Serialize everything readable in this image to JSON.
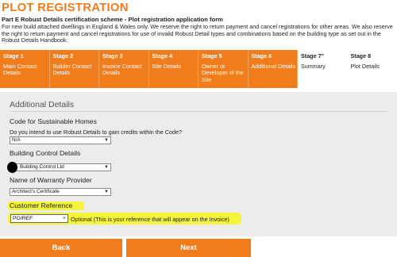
{
  "header": {
    "title": "PLOT REGISTRATION",
    "subtitle": "Part E Robust Details certification scheme - Plot registration application form",
    "intro": "For new build attached dwellings in England & Wales only. We reserve the right to return payment and cancel registrations for other areas. We also reserve the right to return payment and cancel registrations for use of invalid Robust Detail types and combinations based on the building type as set out in the Robust Details Handbook."
  },
  "steps": [
    {
      "label": "Stage 1",
      "desc": "Main Contact Details",
      "state": "completed"
    },
    {
      "label": "Stage 2",
      "desc": "Builder Contact Details",
      "state": "completed"
    },
    {
      "label": "Stage 3",
      "desc": "Invoice Contact Details",
      "state": "completed"
    },
    {
      "label": "Stage 4",
      "desc": "Site Details",
      "state": "completed"
    },
    {
      "label": "Stage 5",
      "desc": "Owner or Developer of the Site",
      "state": "completed"
    },
    {
      "label": "Stage 6",
      "desc": "Additional Details",
      "state": "current"
    },
    {
      "label": "Stage 7\"",
      "desc": "Summary",
      "state": "pending"
    },
    {
      "label": "Stage 8",
      "desc": "Plot Details",
      "state": "pending"
    }
  ],
  "form": {
    "title": "Additional Details",
    "code_section": "Code for Sustainable Homes",
    "code_question": "Do you intend to use Robust Details to gain credits within the Code?",
    "code_value": "N/A",
    "building_control_label": "Building Control Details",
    "building_control_value": "Building Control Ltd",
    "warranty_label": "Name of Warranty Provider",
    "warranty_value": "Architect's Certificate",
    "customer_ref_label": "Customer Reference",
    "customer_ref_value": "PO/REF",
    "customer_ref_note": "Optional (This is your reference that will appear on the Invoice)",
    "clear_symbol": "×"
  },
  "buttons": {
    "back": "Back",
    "next": "Next"
  },
  "colors": {
    "accent": "#f07c1c",
    "highlight": "#f4f43a",
    "panel_bg": "#ececec"
  }
}
